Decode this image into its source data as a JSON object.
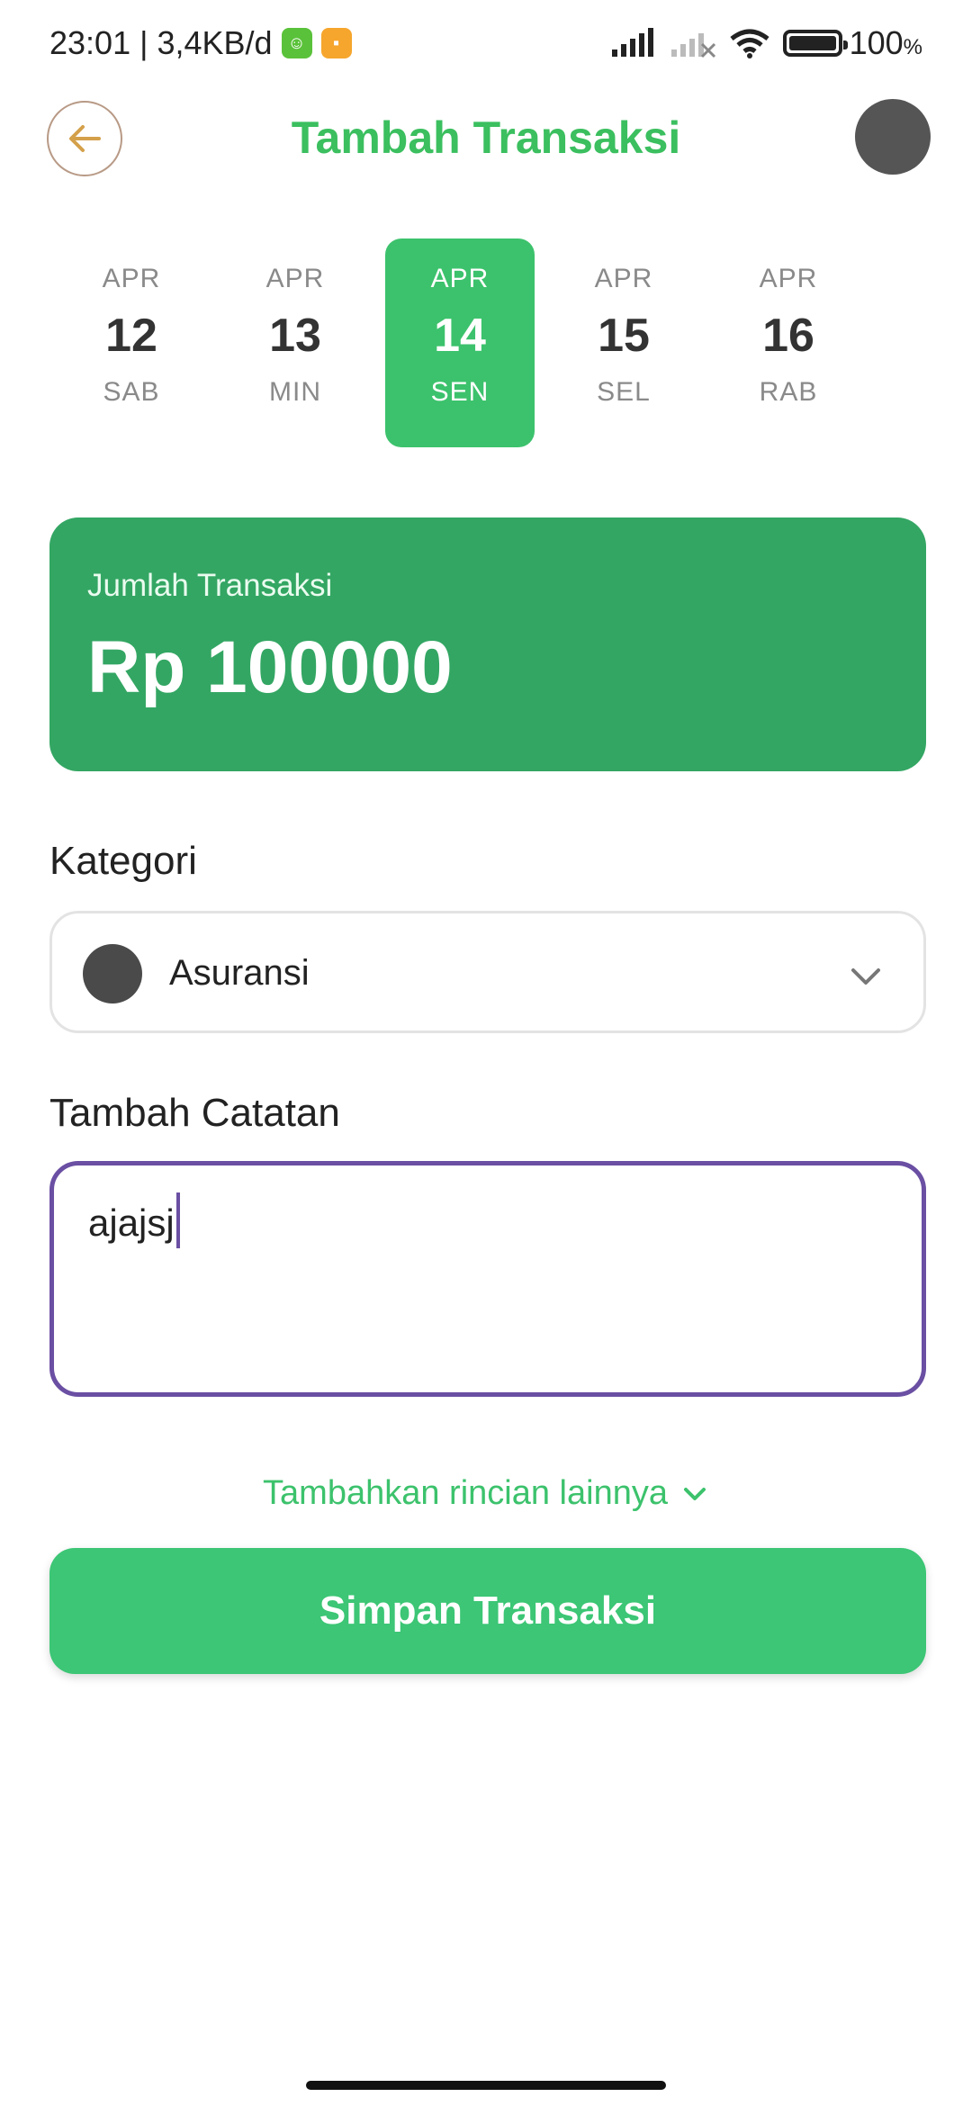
{
  "status_bar": {
    "time": "23:01",
    "network_speed": "3,4KB/d",
    "battery": "100",
    "battery_unit": "%",
    "icons": [
      "signal-icon",
      "signal-off-icon",
      "wifi-icon",
      "battery-icon"
    ]
  },
  "header": {
    "title": "Tambah Transaksi",
    "back_icon": "arrow-left-icon"
  },
  "dates": [
    {
      "month": "APR",
      "day": "12",
      "weekday": "SAB",
      "selected": false
    },
    {
      "month": "APR",
      "day": "13",
      "weekday": "MIN",
      "selected": false
    },
    {
      "month": "APR",
      "day": "14",
      "weekday": "SEN",
      "selected": true
    },
    {
      "month": "APR",
      "day": "15",
      "weekday": "SEL",
      "selected": false
    },
    {
      "month": "APR",
      "day": "16",
      "weekday": "RAB",
      "selected": false
    }
  ],
  "amount": {
    "label": "Jumlah Transaksi",
    "value": "Rp 100000"
  },
  "category": {
    "label": "Kategori",
    "selected": "Asuransi"
  },
  "note": {
    "label": "Tambah Catatan",
    "value": "ajajsj"
  },
  "more_details": {
    "label": "Tambahkan rincian lainnya"
  },
  "save": {
    "label": "Simpan Transaksi"
  },
  "colors": {
    "primary_green": "#3cc26c",
    "card_green": "#33a663",
    "focus_purple": "#6a4fa3"
  }
}
